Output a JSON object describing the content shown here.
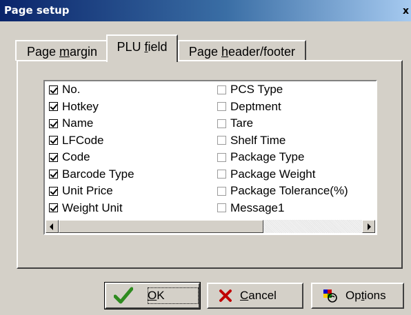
{
  "window": {
    "title": "Page setup",
    "close_label": "x"
  },
  "tabs": [
    {
      "pre": "Page ",
      "u": "m",
      "post": "argin",
      "active": false
    },
    {
      "pre": "PLU ",
      "u": "f",
      "post": "ield",
      "active": true
    },
    {
      "pre": "Page ",
      "u": "h",
      "post": "eader/footer",
      "active": false
    }
  ],
  "fields_left": [
    {
      "label": "No.",
      "checked": true
    },
    {
      "label": "Hotkey",
      "checked": true
    },
    {
      "label": "Name",
      "checked": true
    },
    {
      "label": "LFCode",
      "checked": true
    },
    {
      "label": "Code",
      "checked": true
    },
    {
      "label": "Barcode Type",
      "checked": true
    },
    {
      "label": "Unit Price",
      "checked": true
    },
    {
      "label": "Weight Unit",
      "checked": true
    }
  ],
  "fields_right": [
    {
      "label": "PCS Type",
      "checked": false
    },
    {
      "label": "Deptment",
      "checked": false
    },
    {
      "label": "Tare",
      "checked": false
    },
    {
      "label": "Shelf Time",
      "checked": false
    },
    {
      "label": "Package Type",
      "checked": false
    },
    {
      "label": "Package Weight",
      "checked": false
    },
    {
      "label": "Package Tolerance(%)",
      "checked": false
    },
    {
      "label": "Message1",
      "checked": false
    }
  ],
  "buttons": {
    "ok": {
      "u": "O",
      "post": "K"
    },
    "cancel": {
      "u": "C",
      "post": "ancel"
    },
    "options": {
      "pre": "Op",
      "u": "t",
      "post": "ions"
    }
  },
  "icons": {
    "ok": "check-icon",
    "cancel": "x-icon",
    "options": "options-icon",
    "ok_color": "#2e8b1f",
    "cancel_color": "#c00000"
  }
}
